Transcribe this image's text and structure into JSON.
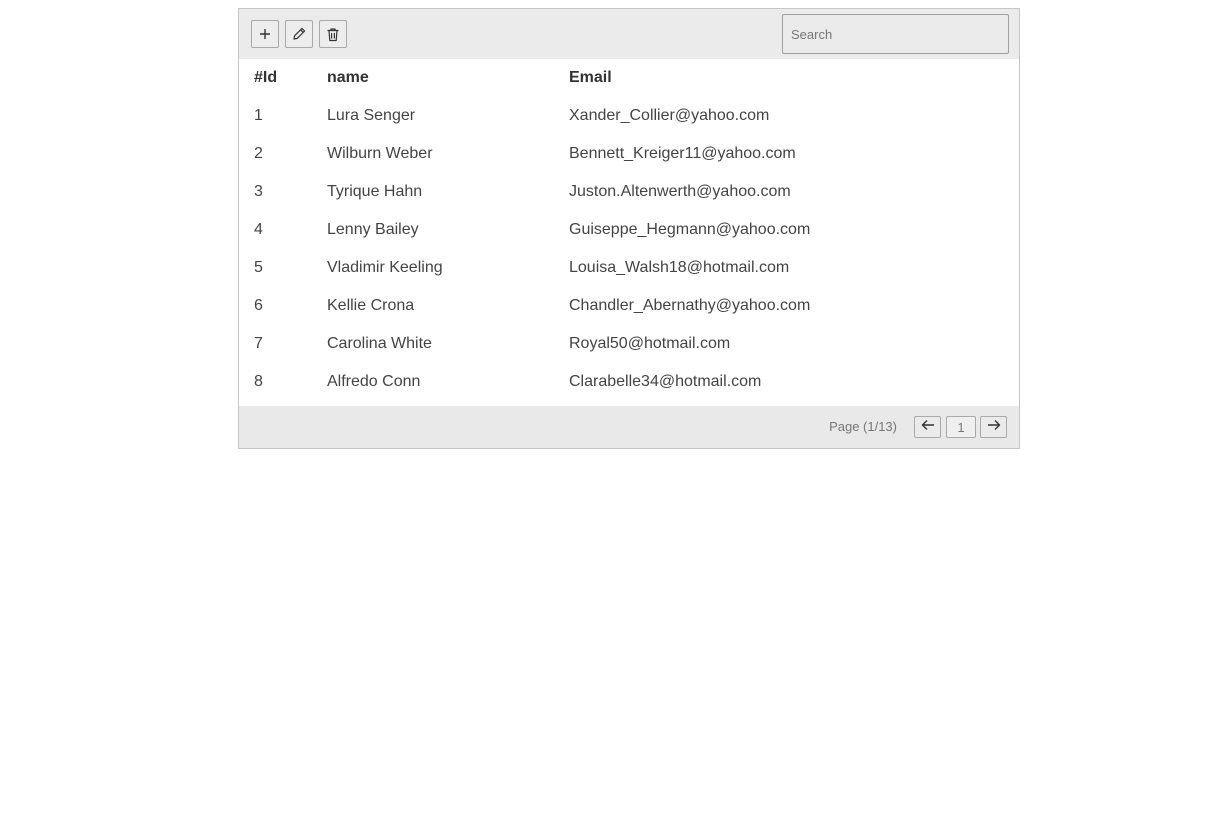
{
  "toolbar": {
    "add_icon": "plus-icon",
    "edit_icon": "pencil-icon",
    "delete_icon": "trash-icon",
    "search_placeholder": "Search",
    "search_value": ""
  },
  "table": {
    "columns": [
      "#Id",
      "name",
      "Email"
    ],
    "rows": [
      {
        "id": "1",
        "name": "Lura Senger",
        "email": "Xander_Collier@yahoo.com"
      },
      {
        "id": "2",
        "name": "Wilburn Weber",
        "email": "Bennett_Kreiger11@yahoo.com"
      },
      {
        "id": "3",
        "name": "Tyrique Hahn",
        "email": "Juston.Altenwerth@yahoo.com"
      },
      {
        "id": "4",
        "name": "Lenny Bailey",
        "email": "Guiseppe_Hegmann@yahoo.com"
      },
      {
        "id": "5",
        "name": "Vladimir Keeling",
        "email": "Louisa_Walsh18@hotmail.com"
      },
      {
        "id": "6",
        "name": "Kellie Crona",
        "email": "Chandler_Abernathy@yahoo.com"
      },
      {
        "id": "7",
        "name": "Carolina White",
        "email": "Royal50@hotmail.com"
      },
      {
        "id": "8",
        "name": "Alfredo Conn",
        "email": "Clarabelle34@hotmail.com"
      }
    ]
  },
  "pagination": {
    "page_label": "Page (1/13)",
    "current_page": "1",
    "prev_icon": "arrow-left-icon",
    "next_icon": "arrow-right-icon"
  },
  "colors": {
    "toolbar_bg": "#ebebeb",
    "border": "#c6c6c6",
    "text": "#333333"
  }
}
